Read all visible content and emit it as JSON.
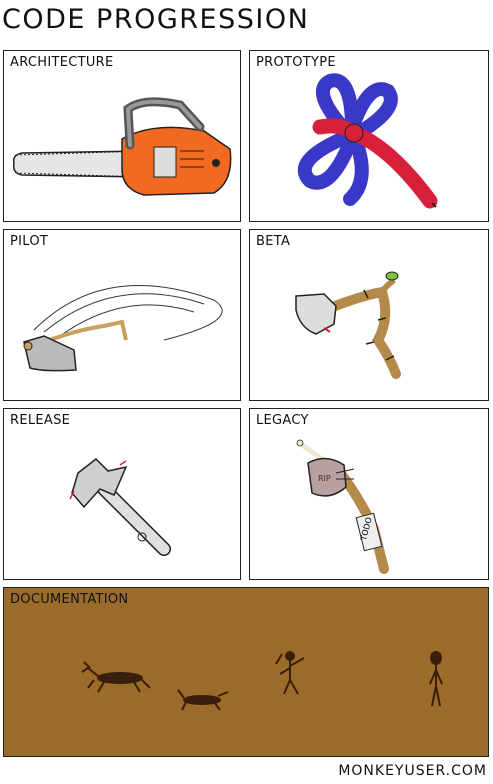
{
  "title": "CODE PROGRESSION",
  "panels": {
    "architecture": "ARCHITECTURE",
    "prototype": "PROTOTYPE",
    "pilot": "PILOT",
    "beta": "BETA",
    "release": "RELEASE",
    "legacy": "LEGACY",
    "documentation": "DOCUMENTATION"
  },
  "legacy_handle_text": "TODO",
  "legacy_head_text": "RIP",
  "footer": "MONKEYUSER.COM",
  "colors": {
    "chainsaw_body": "#f26a21",
    "balloon_blue": "#3a38c8",
    "balloon_red": "#d8203a",
    "documentation_bg": "#9b6b2a",
    "cave_paint": "#3a1e0c"
  }
}
